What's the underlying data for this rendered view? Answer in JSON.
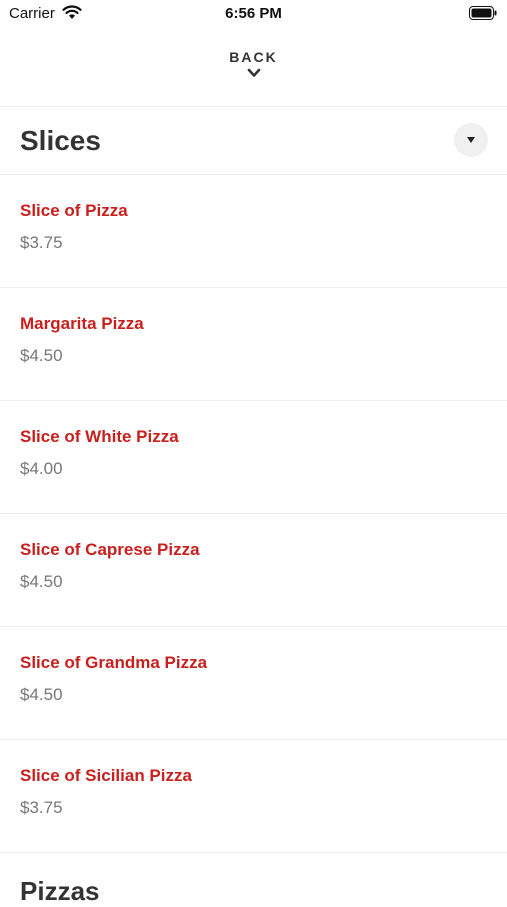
{
  "status_bar": {
    "carrier": "Carrier",
    "time": "6:56 PM"
  },
  "nav": {
    "back_label": "BACK"
  },
  "section": {
    "title": "Slices",
    "items": [
      {
        "name": "Slice of Pizza",
        "price": "$3.75"
      },
      {
        "name": "Margarita Pizza",
        "price": "$4.50"
      },
      {
        "name": "Slice of White Pizza",
        "price": "$4.00"
      },
      {
        "name": "Slice of Caprese Pizza",
        "price": "$4.50"
      },
      {
        "name": "Slice of Grandma Pizza",
        "price": "$4.50"
      },
      {
        "name": "Slice of Sicilian Pizza",
        "price": "$3.75"
      }
    ]
  },
  "next_section": {
    "title": "Pizzas"
  },
  "colors": {
    "item_name": "#c8201e",
    "price": "#777777",
    "text": "#333333"
  }
}
